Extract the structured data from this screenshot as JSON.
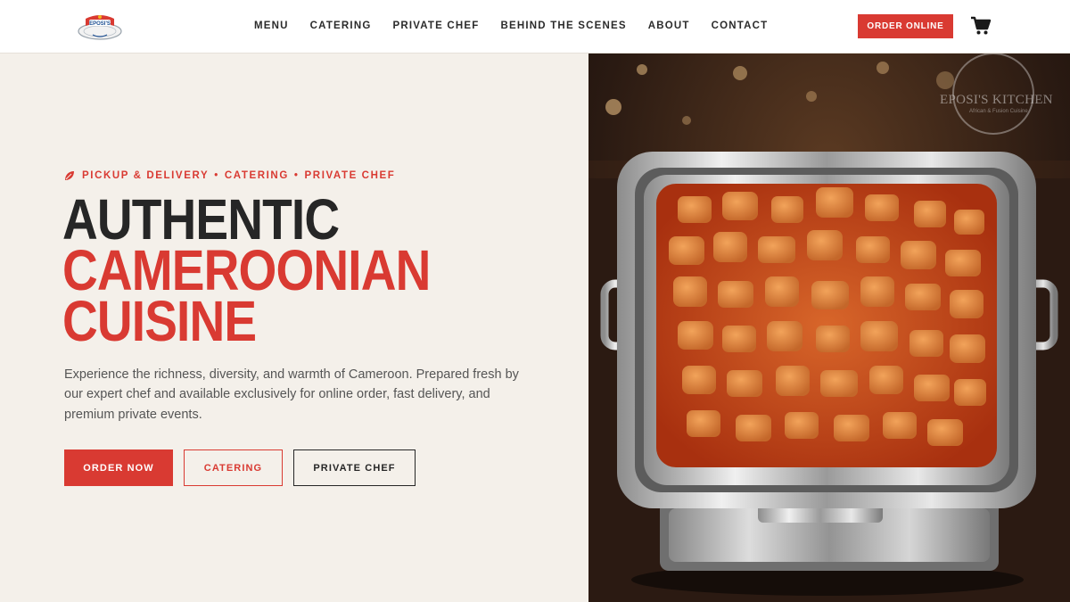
{
  "brand": {
    "logo_icon": "eposis-kitchen-logo",
    "logo_text": "EPOSI'S",
    "accent_color": "#d93a32"
  },
  "nav": {
    "items": [
      {
        "label": "MENU"
      },
      {
        "label": "CATERING"
      },
      {
        "label": "PRIVATE CHEF"
      },
      {
        "label": "BEHIND THE SCENES"
      },
      {
        "label": "ABOUT"
      },
      {
        "label": "CONTACT"
      }
    ],
    "order_online": "ORDER ONLINE",
    "cart_icon": "shopping-cart-icon"
  },
  "hero": {
    "eyebrow": {
      "icon": "leaf-icon",
      "items": [
        "PICKUP & DELIVERY",
        "CATERING",
        "PRIVATE CHEF"
      ],
      "separator": "•"
    },
    "headline": {
      "line1": "AUTHENTIC",
      "line2": "CAMEROONIAN",
      "line3": "CUISINE"
    },
    "description": "Experience the richness, diversity, and warmth of Cameroon. Prepared fresh by our expert chef and available exclusively for online order, fast delivery, and premium private events.",
    "buttons": {
      "order_now": "ORDER NOW",
      "catering": "CATERING",
      "private_chef": "PRIVATE CHEF"
    },
    "image": {
      "watermark": "EPOSI'S KITCHEN",
      "watermark_sub": "African & Fusion Cuisine"
    }
  }
}
